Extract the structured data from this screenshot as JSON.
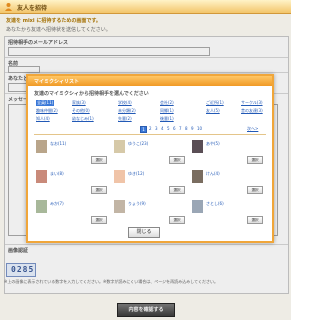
{
  "header": {
    "title": "友人を招待"
  },
  "intro": {
    "line1": "友達を mixi に招待するための画面です。",
    "line2": "あなたから友達へ招待状を送信してください。"
  },
  "form": {
    "email_label": "招待相手のメールアドレス",
    "name_label": "名前",
    "relation_label": "あなたとの関係",
    "message_label": "メッセージ",
    "code_label": "画像認証",
    "code_value": "0285",
    "notes": "※上の画像に表示されている数字を入力してください。※数字が読みにくい場合は、ページを再読み込みしてください。",
    "submit_label": "内容を確認する"
  },
  "modal": {
    "title": "マイミクシィリスト",
    "instruction": "友達のマイミクシィから招待相手を選んでください",
    "categories": [
      {
        "label": "全員(11)",
        "active": true
      },
      {
        "label": "家族(3)"
      },
      {
        "label": "学校(4)"
      },
      {
        "label": "会社(2)"
      },
      {
        "label": "ご近所(1)"
      },
      {
        "label": "サークル(3)"
      },
      {
        "label": "趣味仲間(2)"
      },
      {
        "label": "その他(0)"
      },
      {
        "label": "未分類(2)"
      },
      {
        "label": "同郷(1)"
      },
      {
        "label": "友人(5)"
      },
      {
        "label": "昔の友達(3)"
      },
      {
        "label": "知人(4)"
      },
      {
        "label": "幼なじみ(1)"
      },
      {
        "label": "先輩(2)"
      },
      {
        "label": "後輩(1)"
      }
    ],
    "pages": [
      "1",
      "2",
      "3",
      "4",
      "5",
      "6",
      "7",
      "8",
      "9",
      "10"
    ],
    "next_label": "次へ>",
    "pick_label": "選択",
    "close_label": "閉じる",
    "friends": [
      {
        "name": "なお(11)"
      },
      {
        "name": "ゆうこ(23)"
      },
      {
        "name": "あや(5)"
      },
      {
        "name": "まい(8)"
      },
      {
        "name": "ゆき(12)"
      },
      {
        "name": "けん(4)"
      },
      {
        "name": "みか(7)"
      },
      {
        "name": "りょう(9)"
      },
      {
        "name": "さとし(6)"
      }
    ]
  },
  "colors": {
    "accent": "#f0a63a",
    "link": "#2259b6",
    "active_tab": "#3a78d8"
  }
}
